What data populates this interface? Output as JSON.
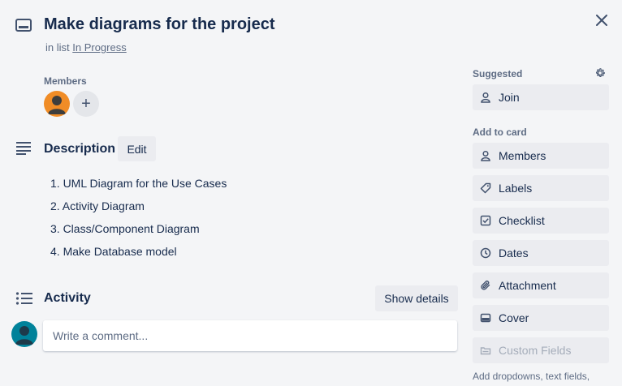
{
  "card": {
    "title": "Make diagrams for the project",
    "list_prefix": "in list",
    "list_name": "In Progress"
  },
  "members": {
    "heading": "Members",
    "add_symbol": "+"
  },
  "description": {
    "heading": "Description",
    "edit_label": "Edit",
    "items": [
      "1. UML Diagram for the Use Cases",
      "2. Activity Diagram",
      "3. Class/Component Diagram",
      "4. Make Database model"
    ]
  },
  "activity": {
    "heading": "Activity",
    "show_details_label": "Show details",
    "comment_placeholder": "Write a comment..."
  },
  "sidebar": {
    "suggested_heading": "Suggested",
    "join_label": "Join",
    "add_to_card_heading": "Add to card",
    "buttons": {
      "members": "Members",
      "labels": "Labels",
      "checklist": "Checklist",
      "dates": "Dates",
      "attachment": "Attachment",
      "cover": "Cover",
      "custom_fields": "Custom Fields"
    },
    "custom_fields_note": "Add dropdowns, text fields,"
  },
  "icons": {
    "card": "card-icon",
    "close": "close-icon",
    "description": "description-lines-icon",
    "activity": "activity-list-icon",
    "gear": "gear-icon",
    "person": "person-icon",
    "tag": "tag-icon",
    "checkbox": "checkbox-icon",
    "clock": "clock-icon",
    "paperclip": "paperclip-icon",
    "cover": "cover-icon",
    "custom_fields": "custom-fields-icon"
  },
  "colors": {
    "background": "#f4f5f7",
    "button_bg": "#ebecf0",
    "text_primary": "#172b4d",
    "text_subtle": "#5e6c84",
    "member_avatar": "#f08c26",
    "user_avatar": "#00829a"
  }
}
